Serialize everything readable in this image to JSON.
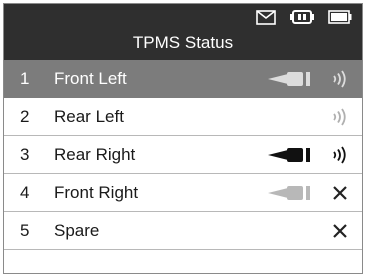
{
  "header": {
    "title": "TPMS Status",
    "icons": [
      "mail-icon",
      "battery-connector-icon",
      "battery-icon"
    ]
  },
  "sensors": [
    {
      "index": "1",
      "name": "Front Left",
      "selected": true,
      "sensor_icon": "sensor-valve-icon",
      "sensor_color": "#dcdcdc",
      "status_icon": "signal-icon",
      "status_color": "#dcdcdc"
    },
    {
      "index": "2",
      "name": "Rear Left",
      "selected": false,
      "sensor_icon": "",
      "status_icon": "signal-icon",
      "status_color": "#b0b0b0"
    },
    {
      "index": "3",
      "name": "Rear Right",
      "selected": false,
      "sensor_icon": "sensor-valve-icon",
      "sensor_color": "#111111",
      "status_icon": "signal-icon",
      "status_color": "#111111"
    },
    {
      "index": "4",
      "name": "Front Right",
      "selected": false,
      "sensor_icon": "sensor-valve-icon",
      "sensor_color": "#b8b8b8",
      "status_icon": "cross-icon",
      "status_color": "#222222"
    },
    {
      "index": "5",
      "name": "Spare",
      "selected": false,
      "sensor_icon": "",
      "status_icon": "cross-icon",
      "status_color": "#222222"
    }
  ]
}
